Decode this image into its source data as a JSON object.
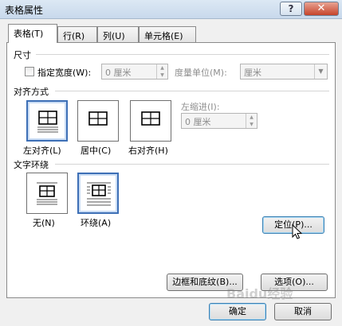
{
  "window": {
    "title": "表格属性",
    "help": "?",
    "close": "✕"
  },
  "tabs": [
    {
      "label": "表格(T)"
    },
    {
      "label": "行(R)"
    },
    {
      "label": "列(U)"
    },
    {
      "label": "单元格(E)"
    }
  ],
  "size": {
    "title": "尺寸",
    "preferred_width_label": "指定宽度(W):",
    "preferred_width_value": "0 厘米",
    "measure_label": "度量单位(M):",
    "measure_value": "厘米"
  },
  "alignment": {
    "title": "对齐方式",
    "options": [
      {
        "label": "左对齐(L)"
      },
      {
        "label": "居中(C)"
      },
      {
        "label": "右对齐(H)"
      }
    ],
    "indent_label": "左缩进(I):",
    "indent_value": "0 厘米"
  },
  "wrapping": {
    "title": "文字环绕",
    "options": [
      {
        "label": "无(N)"
      },
      {
        "label": "环绕(A)"
      }
    ],
    "positioning_button": "定位(P)..."
  },
  "footer": {
    "borders_button": "边框和底纹(B)...",
    "options_button": "选项(O)...",
    "ok_button": "确定",
    "cancel_button": "取消"
  },
  "watermark": "Baidu经验"
}
